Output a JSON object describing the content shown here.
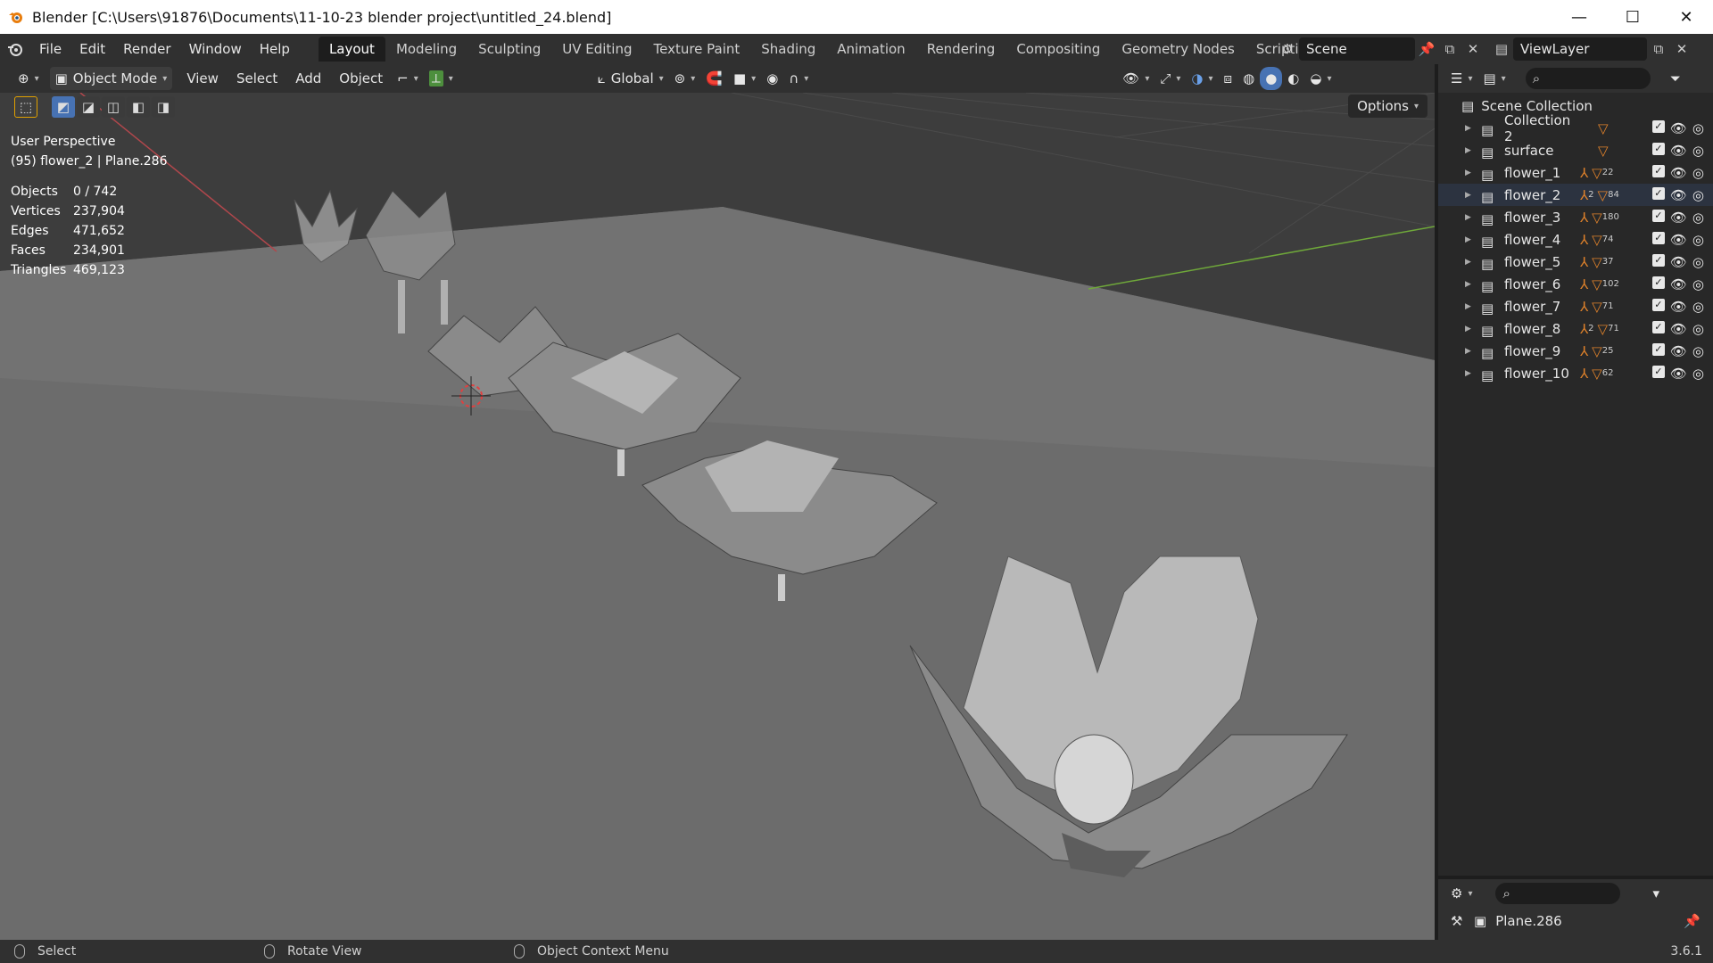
{
  "window": {
    "title": "Blender [C:\\Users\\91876\\Documents\\11-10-23 blender project\\untitled_24.blend]",
    "controls": [
      "minimize-icon",
      "maximize-icon",
      "close-icon"
    ]
  },
  "topbar": {
    "menus": [
      "File",
      "Edit",
      "Render",
      "Window",
      "Help"
    ],
    "workspaces": [
      "Layout",
      "Modeling",
      "Sculpting",
      "UV Editing",
      "Texture Paint",
      "Shading",
      "Animation",
      "Rendering",
      "Compositing",
      "Geometry Nodes",
      "Scripting"
    ],
    "active_workspace": "Layout",
    "scene": "Scene",
    "view_layer": "ViewLayer"
  },
  "viewport_header": {
    "mode": "Object Mode",
    "menus": [
      "View",
      "Select",
      "Add",
      "Object"
    ],
    "orientation": "Global",
    "options_label": "Options"
  },
  "viewport": {
    "perspective": "User Perspective",
    "active": "(95) flower_2 | Plane.286",
    "stats": [
      {
        "label": "Objects",
        "value": "0 / 742"
      },
      {
        "label": "Vertices",
        "value": "237,904"
      },
      {
        "label": "Edges",
        "value": "471,652"
      },
      {
        "label": "Faces",
        "value": "234,901"
      },
      {
        "label": "Triangles",
        "value": "469,123"
      }
    ]
  },
  "outliner": {
    "root": "Scene Collection",
    "items": [
      {
        "name": "Collection 2",
        "armature": "",
        "mesh": ""
      },
      {
        "name": "surface",
        "armature": "",
        "mesh": ""
      },
      {
        "name": "flower_1",
        "armature": "",
        "mesh": "22"
      },
      {
        "name": "flower_2",
        "armature": "2",
        "mesh": "84"
      },
      {
        "name": "flower_3",
        "armature": "",
        "mesh": "180"
      },
      {
        "name": "flower_4",
        "armature": "",
        "mesh": "74"
      },
      {
        "name": "flower_5",
        "armature": "",
        "mesh": "37"
      },
      {
        "name": "flower_6",
        "armature": "",
        "mesh": "102"
      },
      {
        "name": "flower_7",
        "armature": "",
        "mesh": "71"
      },
      {
        "name": "flower_8",
        "armature": "2",
        "mesh": "71"
      },
      {
        "name": "flower_9",
        "armature": "",
        "mesh": "25"
      },
      {
        "name": "flower_10",
        "armature": "",
        "mesh": "62"
      }
    ]
  },
  "properties": {
    "object": "Plane.286"
  },
  "statusbar": {
    "left": "Select",
    "middle": "Rotate View",
    "right": "Object Context Menu",
    "version": "3.6.1"
  },
  "colors": {
    "accent": "#4772b3",
    "orange": "#e0822b",
    "background": "#3f3f3f"
  }
}
